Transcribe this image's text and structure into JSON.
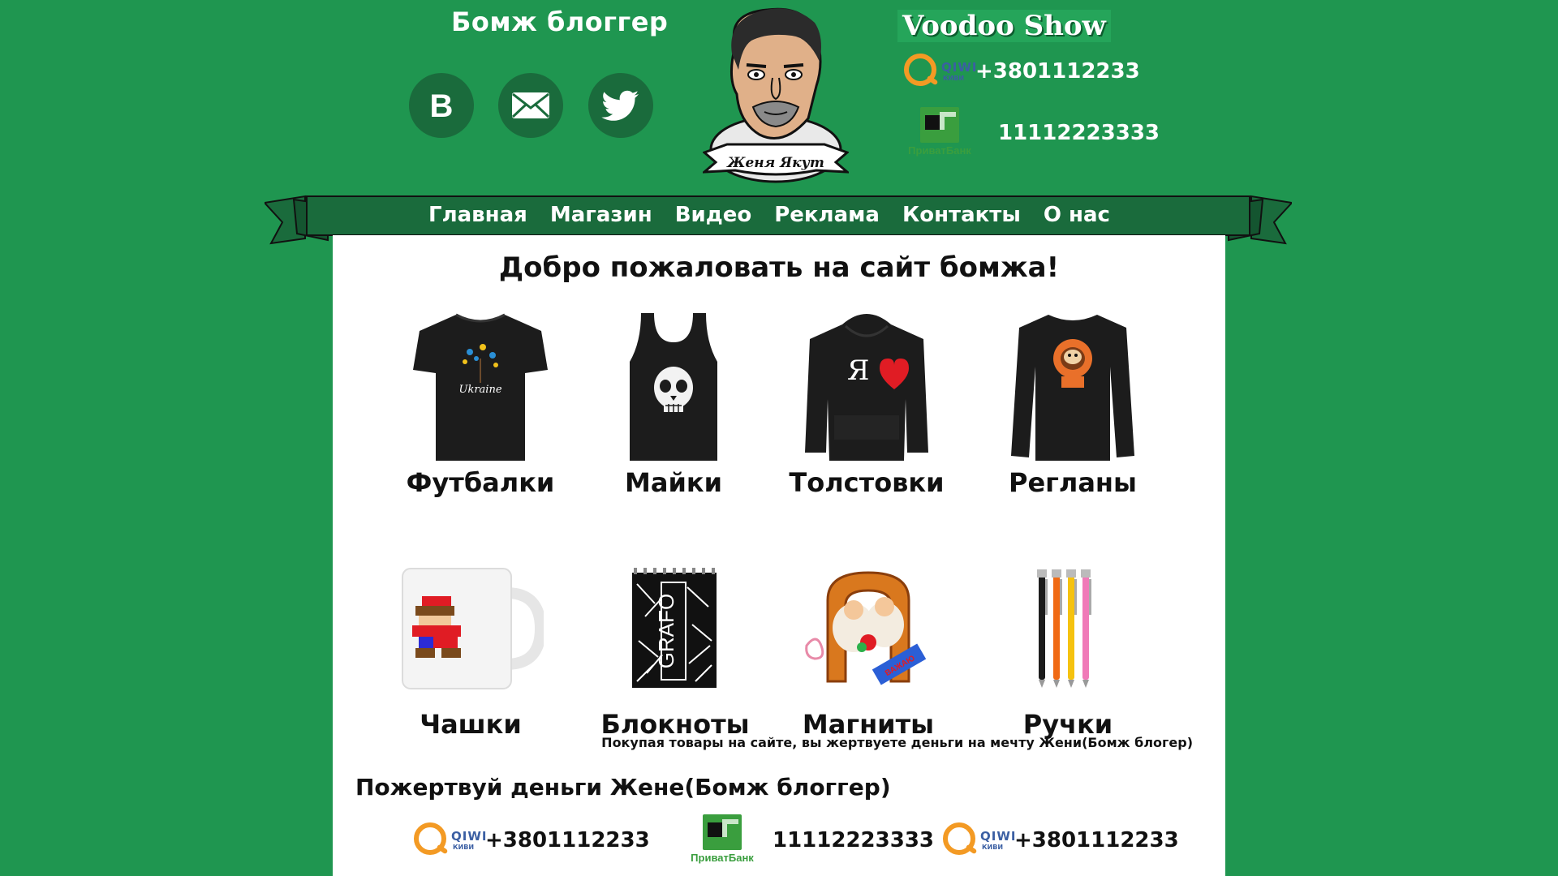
{
  "header": {
    "site_title": "Бомж блоггер",
    "show_title": "Voodoo Show",
    "avatar_caption": "Женя Якут",
    "payments": [
      {
        "logo": "qiwi-logo",
        "word": "QIWI",
        "sub": "КИВИ",
        "value": "+3801112233"
      },
      {
        "logo": "privatbank-logo",
        "word": "ПриватБанк",
        "value": "11112223333"
      }
    ],
    "social": [
      "vk-icon",
      "mail-icon",
      "twitter-icon"
    ]
  },
  "nav": {
    "items": [
      "Главная",
      "Магазин",
      "Видео",
      "Реклама",
      "Контакты",
      "О нас"
    ]
  },
  "main": {
    "welcome": "Добро пожаловать на сайт бомжа!",
    "products": [
      {
        "label": "Футбалки",
        "image": "tshirt-image"
      },
      {
        "label": "Майки",
        "image": "tanktop-image"
      },
      {
        "label": "Толстовки",
        "image": "hoodie-image"
      },
      {
        "label": "Регланы",
        "image": "longsleeve-image"
      },
      {
        "label": "Чашки",
        "image": "mug-image"
      },
      {
        "label": "Блокноты",
        "image": "notebook-image"
      },
      {
        "label": "Магниты",
        "image": "magnet-image"
      },
      {
        "label": "Ручки",
        "image": "pens-image"
      }
    ],
    "note": "Покупая товары на сайте, вы жертвуете деньги на мечту Жени(Бомж блогер)",
    "donate_heading": "Пожертвуй деньги Жене(Бомж блоггер)",
    "donate": [
      {
        "logo": "qiwi-logo",
        "value": "+3801112233"
      },
      {
        "logo": "privatbank-logo",
        "value": "11112223333"
      },
      {
        "logo": "qiwi-logo",
        "value": "+3801112233"
      }
    ]
  },
  "colors": {
    "background": "#1f9650",
    "ribbon": "#1a6b3c",
    "qiwi": "#f39a24",
    "privat": "#3a9e3e"
  }
}
